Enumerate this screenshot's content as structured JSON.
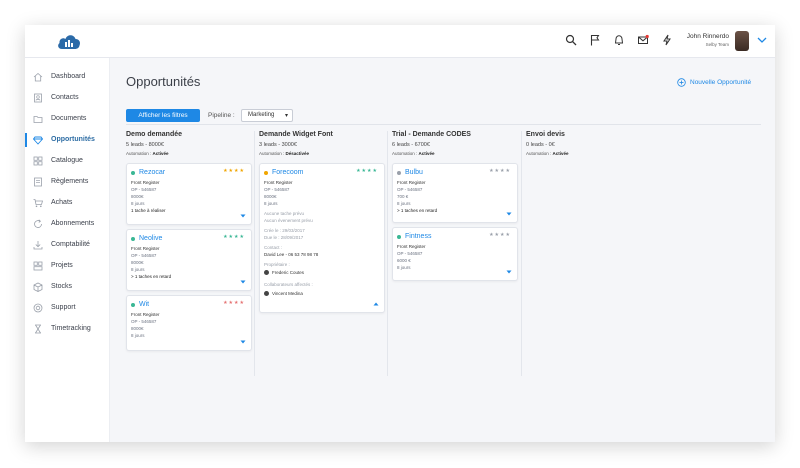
{
  "user": {
    "name": "John Rinnerdo",
    "team": "Selby Team"
  },
  "colors": {
    "accent": "#1e88e5",
    "star_gold": "#f0a500",
    "star_green": "#3ab795",
    "star_blue": "#1e88e5"
  },
  "sidebar": {
    "items": [
      {
        "label": "Dashboard",
        "icon": "home-icon"
      },
      {
        "label": "Contacts",
        "icon": "contacts-icon"
      },
      {
        "label": "Documents",
        "icon": "folder-icon"
      },
      {
        "label": "Opportunités",
        "icon": "diamond-icon",
        "active": true
      },
      {
        "label": "Catalogue",
        "icon": "grid-icon"
      },
      {
        "label": "Règlements",
        "icon": "payments-icon"
      },
      {
        "label": "Achats",
        "icon": "cart-icon"
      },
      {
        "label": "Abonnements",
        "icon": "refresh-icon"
      },
      {
        "label": "Comptabilité",
        "icon": "download-icon"
      },
      {
        "label": "Projets",
        "icon": "projects-icon"
      },
      {
        "label": "Stocks",
        "icon": "box-icon"
      },
      {
        "label": "Support",
        "icon": "lifebuoy-icon"
      },
      {
        "label": "Timetracking",
        "icon": "hourglass-icon"
      }
    ]
  },
  "page": {
    "title": "Opportunités",
    "new_button": "Nouvelle Opportunité",
    "filter_button": "Afficher les filtres",
    "pipeline_label": "Pipeline :",
    "pipeline_value": "Marketing"
  },
  "columns": [
    {
      "title": "Demo demandée",
      "summary": "5 leads - 8000€",
      "automation_label": "Automation :",
      "automation_value": "Activée",
      "cards": [
        {
          "name": "Rezocar",
          "lines": [
            "Front Register",
            "OP - 546587",
            "8000€",
            "8 jours"
          ],
          "task": "1 tache à réaliser",
          "dot": "#3ab795",
          "stars": "★★★★"
        },
        {
          "name": "Neolive",
          "lines": [
            "Front Register",
            "OP - 546587",
            "8000€",
            "8 jours"
          ],
          "task": "> 1 taches en retard",
          "dot": "#3ab795",
          "stars": "★★★★"
        },
        {
          "name": "Wit",
          "lines": [
            "Front Register",
            "OP - 546587",
            "8000€",
            "8 jours"
          ],
          "task": "",
          "dot": "#3ab795",
          "stars": "★★★★"
        }
      ]
    },
    {
      "title": "Demande Widget Font",
      "summary": "3 leads - 3000€",
      "automation_label": "Automation :",
      "automation_value": "Désactivée",
      "cards": [
        {
          "name": "Forecoom",
          "lines": [
            "Front Register",
            "OP - 546587",
            "8000€",
            "8 jours"
          ],
          "extra": [
            "Aucune tache prévu",
            "Aucun évenement prévu",
            "Crée le : 29/03/2017",
            "Due le : 28/09/2017"
          ],
          "contact_label": "Contact :",
          "contact_value": "David Lee - 06 53 78 98 78",
          "owner_label": "Propriétaire :",
          "owner_value": "Frederic Coutes",
          "collab_label": "Collaborateurs affectés :",
          "collab_value": "Vincent Medina",
          "dot": "#f0a500",
          "stars": "★★★★"
        }
      ]
    },
    {
      "title": "Trial - Demande CODES",
      "summary": "6 leads - 6700€",
      "automation_label": "Automation :",
      "automation_value": "Activée",
      "cards": [
        {
          "name": "Bulbu",
          "lines": [
            "Front Register",
            "OP - 546587",
            "700 €",
            "8 jours"
          ],
          "task": "> 1 taches en retard",
          "dot": "#9aa0aa",
          "stars": "★★★★"
        },
        {
          "name": "Fintness",
          "lines": [
            "Front Register",
            "OP - 546587",
            "6000 €",
            "8 jours"
          ],
          "task": "",
          "dot": "#3ab795",
          "stars": "★★★★"
        }
      ]
    },
    {
      "title": "Envoi devis",
      "summary": "0 leads - 0€",
      "automation_label": "Automation :",
      "automation_value": "Activée",
      "cards": []
    }
  ]
}
